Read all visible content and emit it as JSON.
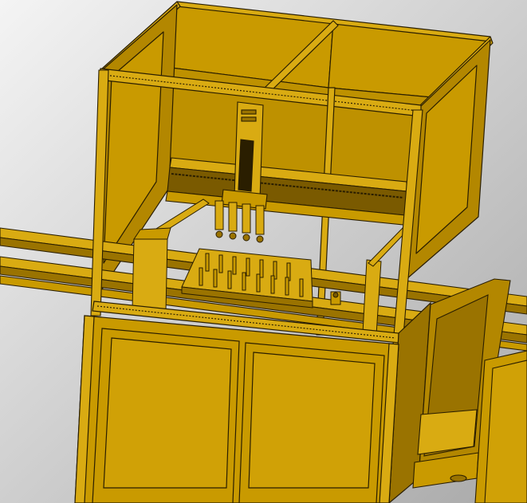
{
  "scene": {
    "subject": "cad-gantry-dispensing-machine",
    "colors": {
      "background_light": "#f4f4f4",
      "background_dark": "#a9a9a9",
      "body": "#c99a00",
      "body_light": "#d9ab12",
      "body_dark": "#9a7300",
      "body_deep": "#7a5a00",
      "edge": "#2a1e00"
    },
    "components": [
      "enclosure-frame",
      "gantry-beam",
      "z-axis-head",
      "nozzle-array",
      "work-fixture-plate",
      "conveyor-rail",
      "base-cabinet",
      "side-cabinet"
    ]
  }
}
